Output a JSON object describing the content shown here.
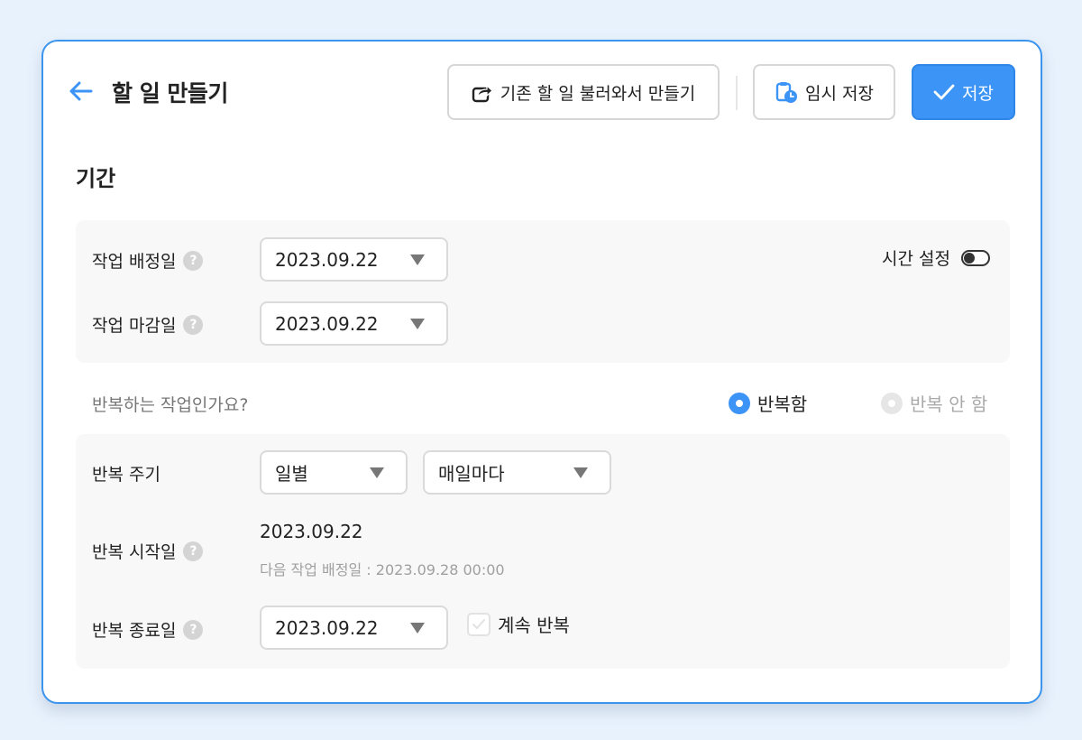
{
  "header": {
    "title": "할 일 만들기",
    "load_button": "기존 할 일 불러와서 만들기",
    "draft_button": "임시 저장",
    "save_button": "저장"
  },
  "period": {
    "section_title": "기간",
    "assign_label": "작업 배정일",
    "assign_date": "2023.09.22",
    "due_label": "작업 마감일",
    "due_date": "2023.09.22",
    "time_setting_label": "시간 설정",
    "time_setting_on": false
  },
  "repeat": {
    "question": "반복하는 작업인가요?",
    "option_yes": "반복함",
    "option_no": "반복 안 함",
    "selected": "반복함",
    "cycle_label": "반복 주기",
    "cycle_unit": "일별",
    "cycle_frequency": "매일마다",
    "start_label": "반복 시작일",
    "start_date": "2023.09.22",
    "next_assign_note": "다음 작업 배정일 : 2023.09.28 00:00",
    "end_label": "반복 종료일",
    "end_date": "2023.09.22",
    "continuous_label": "계속 반복",
    "continuous_checked": false
  },
  "icons": {
    "back": "arrow-left-icon",
    "load": "share-arrow-icon",
    "draft": "clipboard-clock-icon",
    "save": "check-icon",
    "help": "question-mark-icon"
  },
  "colors": {
    "accent": "#3b94f6",
    "background": "#e8f2fd",
    "panel": "#f8f8f8"
  }
}
